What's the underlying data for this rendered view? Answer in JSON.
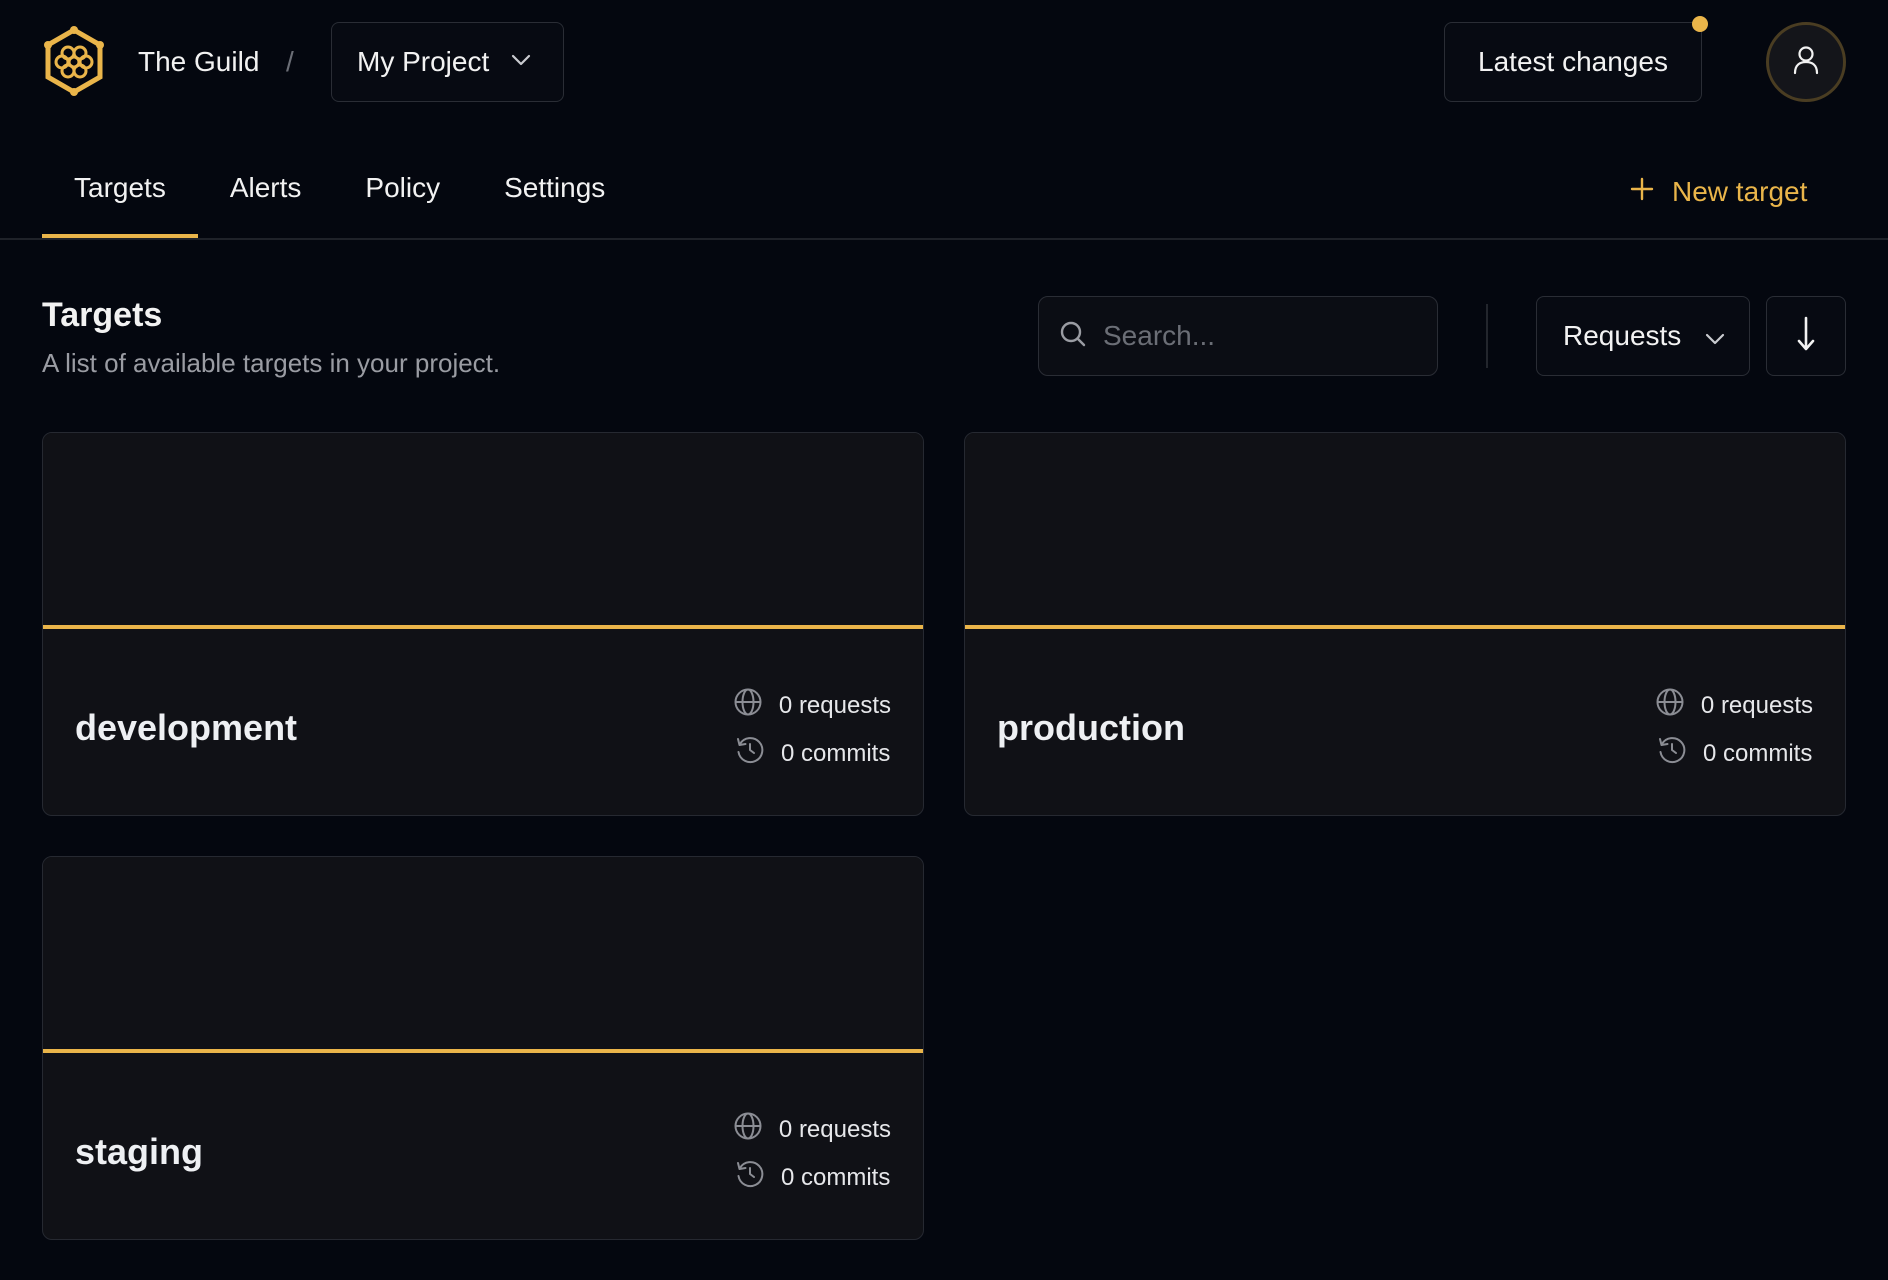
{
  "header": {
    "org_name": "The Guild",
    "separator": "/",
    "project": "My Project",
    "latest_changes": "Latest changes",
    "accent_color": "#eab54a"
  },
  "tabs": [
    {
      "label": "Targets",
      "active": true
    },
    {
      "label": "Alerts",
      "active": false
    },
    {
      "label": "Policy",
      "active": false
    },
    {
      "label": "Settings",
      "active": false
    }
  ],
  "new_target_label": "New target",
  "section": {
    "title": "Targets",
    "description": "A list of available targets in your project."
  },
  "search": {
    "placeholder": "Search...",
    "value": ""
  },
  "sort": {
    "selected": "Requests",
    "direction": "descending"
  },
  "targets": [
    {
      "name": "development",
      "requests": "0 requests",
      "commits": "0 commits"
    },
    {
      "name": "production",
      "requests": "0 requests",
      "commits": "0 commits"
    },
    {
      "name": "staging",
      "requests": "0 requests",
      "commits": "0 commits"
    }
  ]
}
